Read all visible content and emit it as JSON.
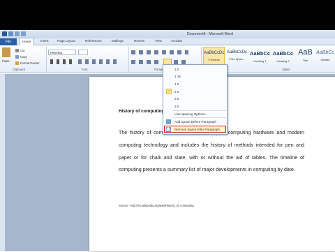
{
  "window": {
    "title": "Document6 - Microsoft Word"
  },
  "tabs": {
    "file": "File",
    "home": "Home",
    "insert": "Insert",
    "page_layout": "Page Layout",
    "references": "References",
    "mailings": "Mailings",
    "review": "Review",
    "view": "View",
    "acrobat": "Acrobat"
  },
  "clipboard": {
    "paste": "Paste",
    "cut": "Cut",
    "copy": "Copy",
    "format_painter": "Format Painter",
    "label": "Clipboard"
  },
  "font": {
    "name": "Helvetica",
    "label": "Font"
  },
  "paragraph": {
    "label": "Paragraph"
  },
  "styles": {
    "label": "Styles",
    "items": [
      {
        "sample": "AaBbCcDc",
        "name": "¶ Normal"
      },
      {
        "sample": "AaBbCcDc",
        "name": "¶ No Spaci..."
      },
      {
        "sample": "AaBbCc",
        "name": "Heading 1"
      },
      {
        "sample": "AaBbCc",
        "name": "Heading 2"
      },
      {
        "sample": "AaB",
        "name": "Title"
      },
      {
        "sample": "AaBbCc",
        "name": "Subtitle"
      }
    ]
  },
  "spacing_menu": {
    "values": [
      "1.0",
      "1.15",
      "1.5",
      "2.0",
      "2.5",
      "3.0"
    ],
    "checked": "2.0",
    "line_options": "Line Spacing Options...",
    "add_before": "Add Space Before Paragraph",
    "remove_after": "Remove Space After Paragraph"
  },
  "document": {
    "heading": "History of computing",
    "paragraph": "The history of computing hardware is the history of computing hardware and modern computing technology and includes the history of methods intended for pen and paper or for chalk and slate, with or without the aid of tables. The timeline of computing presents a summary list of major developments in computing by date.",
    "para_head": "The history of com",
    "para_tail": "tory of computing hardware and",
    "para_rest": "modern computing technology and includes the history of methods intended for pen and paper or for chalk and slate, with or without the aid of tables. The timeline of computing presents a summary list of major developments in computing by date.",
    "source": "Source - http://en.wikipedia.org/wiki/History_of_computing"
  },
  "colors": {
    "file_tab": "#2a5ea8",
    "highlight_border": "#c42020",
    "check": "#fde89a"
  }
}
